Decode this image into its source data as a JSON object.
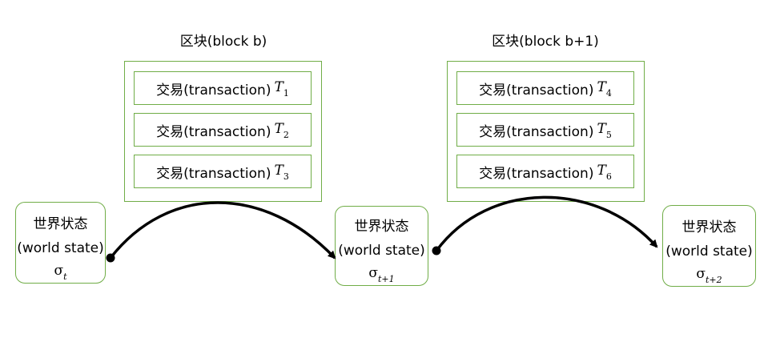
{
  "blocks": [
    {
      "title": "区块(block b)",
      "transactions": [
        {
          "label": "交易(transaction)",
          "symbol": "T",
          "sub": "1"
        },
        {
          "label": "交易(transaction)",
          "symbol": "T",
          "sub": "2"
        },
        {
          "label": "交易(transaction)",
          "symbol": "T",
          "sub": "3"
        }
      ]
    },
    {
      "title": "区块(block b+1)",
      "transactions": [
        {
          "label": "交易(transaction)",
          "symbol": "T",
          "sub": "4"
        },
        {
          "label": "交易(transaction)",
          "symbol": "T",
          "sub": "5"
        },
        {
          "label": "交易(transaction)",
          "symbol": "T",
          "sub": "6"
        }
      ]
    }
  ],
  "states": [
    {
      "label_cn": "世界状态",
      "label_en": "(world state)",
      "symbol": "σ",
      "sub": "t"
    },
    {
      "label_cn": "世界状态",
      "label_en": "(world state)",
      "symbol": "σ",
      "sub": "t+1"
    },
    {
      "label_cn": "世界状态",
      "label_en": "(world state)",
      "symbol": "σ",
      "sub": "t+2"
    }
  ],
  "colors": {
    "box_border": "#70ad47",
    "arrow": "#000000"
  }
}
